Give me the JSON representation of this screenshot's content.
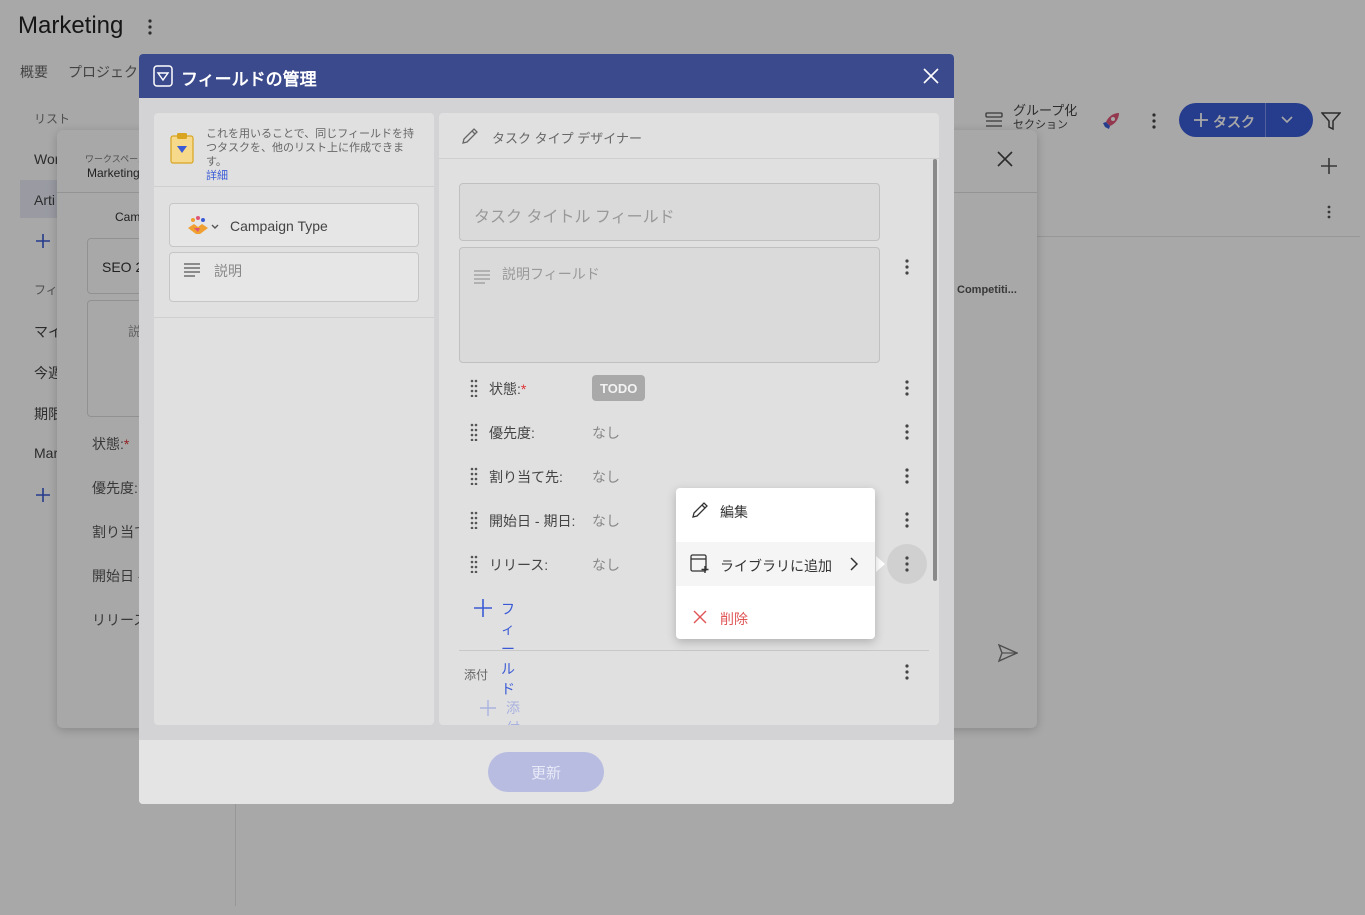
{
  "app": {
    "title": "Marketing",
    "tabs": [
      "概要",
      "プロジェクト"
    ],
    "left_panel": {
      "list_header": "リスト",
      "lists": [
        "Wor",
        "Arti"
      ],
      "filter_header": "フィル",
      "filters": [
        "マイ",
        "今週",
        "期限",
        "Mar"
      ]
    },
    "toolbar": {
      "group_label_1": "グループ化",
      "group_label_2": "セクション",
      "task_button": "タスク"
    },
    "row_text": "Competiti..."
  },
  "bg_dialog": {
    "workspace_label": "ワークスペース",
    "workspace_name": "Marketing",
    "campaign": "Cam",
    "seo": "SEO 2",
    "desc_stub": "説",
    "fields": [
      "状態:",
      "優先度:",
      "割り当て",
      "開始日 -",
      "リリース:"
    ],
    "required_mark": "*"
  },
  "modal": {
    "title": "フィールドの管理",
    "info_text": "これを用いることで、同じフィールドを持つタスクを、他のリスト上に作成できます。",
    "info_link": "詳細",
    "left_fields": {
      "campaign_type": "Campaign Type",
      "description": "説明"
    },
    "designer_title": "タスク タイプ デザイナー",
    "title_field": "タスク タイトル フィールド",
    "description_field": "説明フィールド",
    "field_rows": [
      {
        "label": "状態:",
        "value": "TODO",
        "required": "*"
      },
      {
        "label": "優先度:",
        "value": "なし"
      },
      {
        "label": "割り当て先:",
        "value": "なし"
      },
      {
        "label": "開始日 - 期日:",
        "value": "なし"
      },
      {
        "label": "リリース:",
        "value": "なし"
      }
    ],
    "add_field": "フィールド",
    "attachments_label": "添付",
    "add_attachment": "添付の追加",
    "update_button": "更新"
  },
  "context_menu": {
    "edit": "編集",
    "add_to_library": "ライブラリに追加",
    "delete": "削除"
  },
  "colors": {
    "header": "#3b4a8c",
    "accent": "#3b5bd6",
    "danger": "#e05555"
  }
}
